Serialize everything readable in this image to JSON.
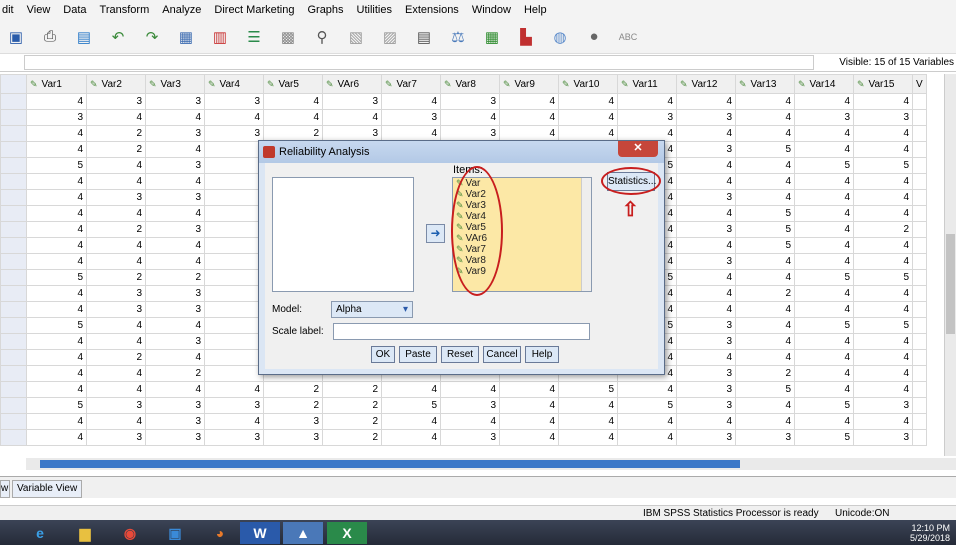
{
  "menu": [
    "dit",
    "View",
    "Data",
    "Transform",
    "Analyze",
    "Direct Marketing",
    "Graphs",
    "Utilities",
    "Extensions",
    "Window",
    "Help"
  ],
  "toolbar_icons": [
    "save-icon",
    "print-icon",
    "recall-dialog-icon",
    "undo-icon",
    "redo-icon",
    "goto-case-icon",
    "goto-variable-icon",
    "variables-icon",
    "run-descriptives-icon",
    "find-icon",
    "insert-cases-icon",
    "insert-variable-icon",
    "split-file-icon",
    "weight-cases-icon",
    "select-cases-icon",
    "value-labels-icon",
    "use-sets-icon",
    "show-all-icon",
    "spell-check-icon"
  ],
  "visible_text": "Visible: 15 of 15 Variables",
  "columns": [
    "Var1",
    "Var2",
    "Var3",
    "Var4",
    "Var5",
    "VAr6",
    "Var7",
    "Var8",
    "Var9",
    "Var10",
    "Var11",
    "Var12",
    "Var13",
    "Var14",
    "Var15",
    "V"
  ],
  "rows": [
    [
      "4",
      "3",
      "3",
      "3",
      "4",
      "3",
      "4",
      "3",
      "4",
      "4",
      "4",
      "4",
      "4",
      "4",
      "4"
    ],
    [
      "3",
      "4",
      "4",
      "4",
      "4",
      "4",
      "3",
      "4",
      "4",
      "4",
      "3",
      "3",
      "4",
      "3",
      "3"
    ],
    [
      "4",
      "2",
      "3",
      "3",
      "2",
      "3",
      "4",
      "3",
      "4",
      "4",
      "4",
      "4",
      "4",
      "4",
      "4"
    ],
    [
      "4",
      "2",
      "4",
      "",
      "",
      "",
      "",
      "",
      "",
      "",
      "4",
      "3",
      "5",
      "4",
      "4"
    ],
    [
      "5",
      "4",
      "3",
      "",
      "",
      "",
      "",
      "",
      "",
      "",
      "5",
      "4",
      "4",
      "5",
      "5"
    ],
    [
      "4",
      "4",
      "4",
      "",
      "",
      "",
      "",
      "",
      "",
      "",
      "4",
      "4",
      "4",
      "4",
      "4"
    ],
    [
      "4",
      "3",
      "3",
      "",
      "",
      "",
      "",
      "",
      "",
      "",
      "4",
      "3",
      "4",
      "4",
      "4"
    ],
    [
      "4",
      "4",
      "4",
      "",
      "",
      "",
      "",
      "",
      "",
      "",
      "4",
      "4",
      "5",
      "4",
      "4"
    ],
    [
      "4",
      "2",
      "3",
      "",
      "",
      "",
      "",
      "",
      "",
      "",
      "4",
      "3",
      "5",
      "4",
      "2"
    ],
    [
      "4",
      "4",
      "4",
      "",
      "",
      "",
      "",
      "",
      "",
      "",
      "4",
      "4",
      "5",
      "4",
      "4"
    ],
    [
      "4",
      "4",
      "4",
      "",
      "",
      "",
      "",
      "",
      "",
      "",
      "4",
      "3",
      "4",
      "4",
      "4"
    ],
    [
      "5",
      "2",
      "2",
      "",
      "",
      "",
      "",
      "",
      "",
      "",
      "5",
      "4",
      "4",
      "5",
      "5"
    ],
    [
      "4",
      "3",
      "3",
      "",
      "",
      "",
      "",
      "",
      "",
      "",
      "4",
      "4",
      "2",
      "4",
      "4"
    ],
    [
      "4",
      "3",
      "3",
      "",
      "",
      "",
      "",
      "",
      "",
      "",
      "4",
      "4",
      "4",
      "4",
      "4"
    ],
    [
      "5",
      "4",
      "4",
      "",
      "",
      "",
      "",
      "",
      "",
      "",
      "5",
      "3",
      "4",
      "5",
      "5"
    ],
    [
      "4",
      "4",
      "3",
      "",
      "",
      "",
      "",
      "",
      "",
      "",
      "4",
      "3",
      "4",
      "4",
      "4"
    ],
    [
      "4",
      "2",
      "4",
      "",
      "",
      "",
      "",
      "",
      "",
      "",
      "4",
      "4",
      "4",
      "4",
      "4"
    ],
    [
      "4",
      "4",
      "2",
      "",
      "",
      "",
      "",
      "",
      "",
      "",
      "4",
      "3",
      "2",
      "4",
      "4"
    ],
    [
      "4",
      "4",
      "4",
      "4",
      "2",
      "2",
      "4",
      "4",
      "4",
      "5",
      "4",
      "3",
      "5",
      "4",
      "4"
    ],
    [
      "5",
      "3",
      "3",
      "3",
      "2",
      "2",
      "5",
      "3",
      "4",
      "4",
      "5",
      "3",
      "4",
      "5",
      "3"
    ],
    [
      "4",
      "4",
      "3",
      "4",
      "3",
      "2",
      "4",
      "4",
      "4",
      "4",
      "4",
      "4",
      "4",
      "4",
      "4"
    ],
    [
      "4",
      "3",
      "3",
      "3",
      "3",
      "2",
      "4",
      "3",
      "4",
      "4",
      "4",
      "3",
      "3",
      "5",
      "3"
    ]
  ],
  "view_tab": "Variable View",
  "view_tab_prefix": "w",
  "status_processor": "IBM SPSS Statistics Processor is ready",
  "status_unicode": "Unicode:ON",
  "clock_time": "12:10 PM",
  "clock_date": "5/29/2018",
  "dialog": {
    "title": "Reliability Analysis",
    "close": "✕",
    "items_label": "Items:",
    "items": [
      "Var",
      "Var2",
      "Var3",
      "Var4",
      "Var5",
      "VAr6",
      "Var7",
      "Var8",
      "Var9"
    ],
    "statistics": "Statistics...",
    "model_label": "Model:",
    "model_value": "Alpha",
    "scale_label": "Scale label:",
    "buttons": {
      "ok": "OK",
      "paste": "Paste",
      "reset": "Reset",
      "cancel": "Cancel",
      "help": "Help"
    }
  },
  "colors": {
    "items_bg": "#fce8a6",
    "annotation": "#c81e1e",
    "dialog_bg": "#dbe6f4"
  }
}
